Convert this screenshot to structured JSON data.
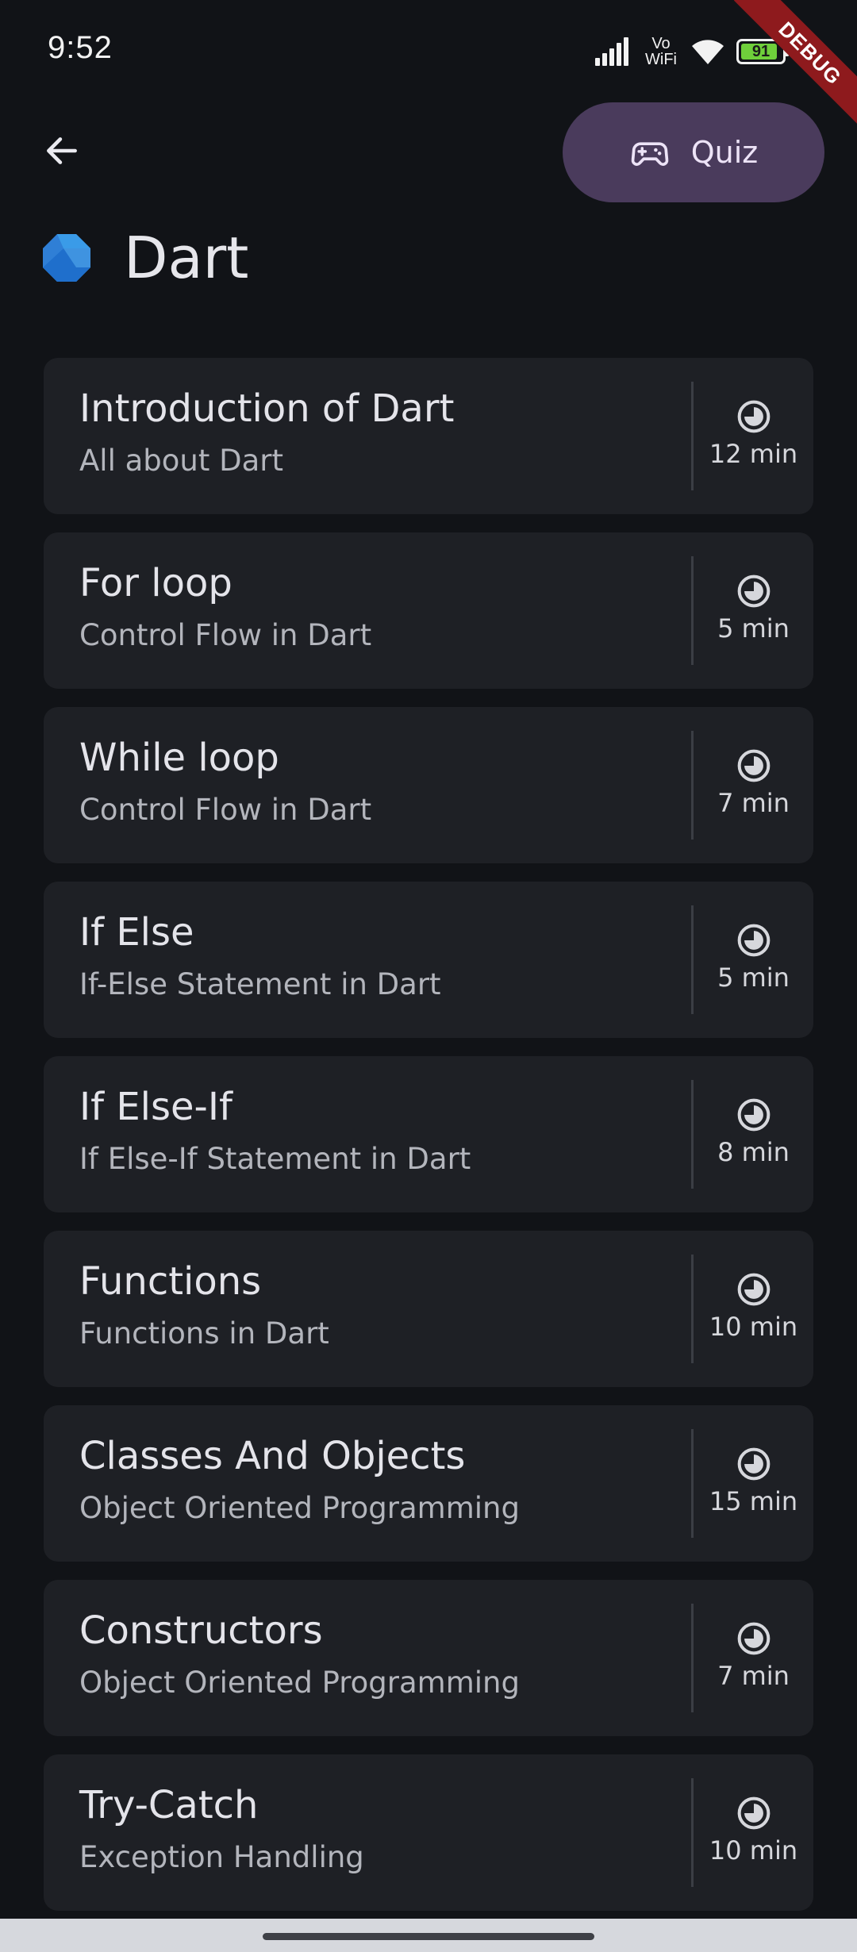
{
  "status_bar": {
    "time": "9:52",
    "network_label": "Vo\nWiFi",
    "battery_level": "91",
    "battery_fraction": 0.91,
    "icons": [
      "signal-icon",
      "wifi-icon",
      "battery-icon"
    ]
  },
  "debug_banner": "DEBUG",
  "app_bar": {
    "back_icon": "arrow-left-icon",
    "quiz_icon": "gamepad-icon",
    "quiz_label": "Quiz",
    "quiz_button_color": "#4a3b5c"
  },
  "page": {
    "title": "Dart",
    "logo": "dart-logo-icon"
  },
  "colors": {
    "background": "#111317",
    "card": "#1e2025",
    "accent_dart_blue": "#2f7fd6"
  },
  "topics": [
    {
      "title": "Introduction of Dart",
      "subtitle": "All about Dart",
      "duration": "12 min"
    },
    {
      "title": "For loop",
      "subtitle": "Control Flow in Dart",
      "duration": "5 min"
    },
    {
      "title": "While loop",
      "subtitle": "Control Flow in Dart",
      "duration": "7 min"
    },
    {
      "title": "If Else",
      "subtitle": "If-Else Statement in Dart",
      "duration": "5 min"
    },
    {
      "title": "If Else-If",
      "subtitle": "If Else-If Statement in Dart",
      "duration": "8 min"
    },
    {
      "title": "Functions",
      "subtitle": "Functions in Dart",
      "duration": "10 min"
    },
    {
      "title": "Classes And Objects",
      "subtitle": "Object Oriented Programming",
      "duration": "15 min"
    },
    {
      "title": "Constructors",
      "subtitle": "Object Oriented Programming",
      "duration": "7 min"
    },
    {
      "title": "Try-Catch",
      "subtitle": "Exception Handling",
      "duration": "10 min"
    }
  ]
}
